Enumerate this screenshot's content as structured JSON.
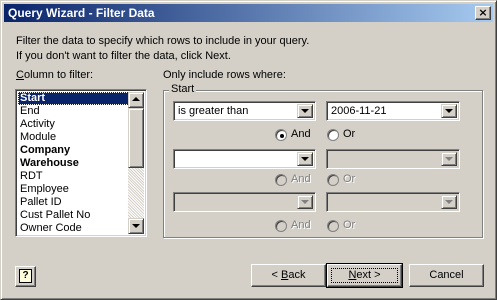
{
  "window": {
    "title": "Query Wizard - Filter Data",
    "close_glyph": "×"
  },
  "intro": {
    "line1": "Filter the data to specify which rows to include in your query.",
    "line2": "If you don't want to filter the data, click Next."
  },
  "column_filter": {
    "label_accel": "C",
    "label_rest": "olumn to filter:",
    "items": [
      {
        "label": "Start",
        "bold": true,
        "selected": true
      },
      {
        "label": "End",
        "bold": false,
        "selected": false
      },
      {
        "label": "Activity",
        "bold": false,
        "selected": false
      },
      {
        "label": "Module",
        "bold": false,
        "selected": false
      },
      {
        "label": "Company",
        "bold": true,
        "selected": false
      },
      {
        "label": "Warehouse",
        "bold": true,
        "selected": false
      },
      {
        "label": "RDT",
        "bold": false,
        "selected": false
      },
      {
        "label": "Employee",
        "bold": false,
        "selected": false
      },
      {
        "label": "Pallet ID",
        "bold": false,
        "selected": false
      },
      {
        "label": "Cust Pallet No",
        "bold": false,
        "selected": false
      },
      {
        "label": "Owner Code",
        "bold": false,
        "selected": false
      }
    ]
  },
  "criteria": {
    "label": "Only include rows where:",
    "group_title": "Start",
    "rows": [
      {
        "operator": "is greater than",
        "value": "2006-11-21",
        "enabled": true
      },
      {
        "operator": "",
        "value": "",
        "enabled": false
      },
      {
        "operator": "",
        "value": "",
        "enabled": false
      }
    ],
    "and_label": "And",
    "or_label": "Or"
  },
  "buttons": {
    "help_glyph": "?",
    "back_prefix": "< ",
    "back_accel": "B",
    "back_rest": "ack",
    "next_accel": "N",
    "next_rest": "ext >",
    "cancel": "Cancel"
  },
  "colors": {
    "titlebar_start": "#0a246a",
    "titlebar_end": "#a6caf0",
    "selection": "#0a246a",
    "dialog_bg": "#d4d0c8"
  }
}
